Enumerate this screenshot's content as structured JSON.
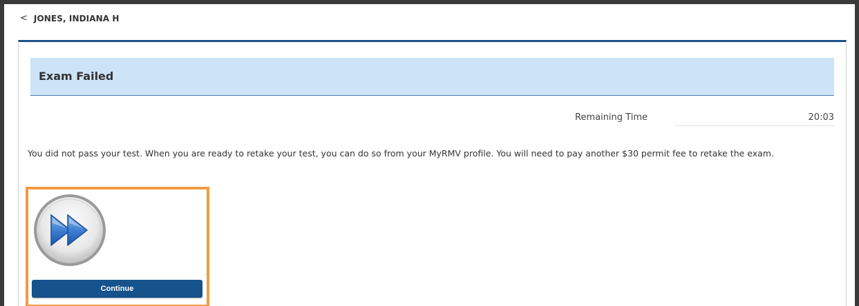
{
  "header": {
    "back_chevron": "<",
    "person_name": "JONES, INDIANA H"
  },
  "exam": {
    "title": "Exam Failed",
    "timer_label": "Remaining Time",
    "timer_value": "20:03",
    "message": "You did not pass your test. When you are ready to retake your test, you can do so from your MyRMV profile.  You will need to pay another $30 permit fee to retake the exam.",
    "continue_icon": "fast-forward-icon",
    "continue_label": "Continue"
  },
  "colors": {
    "accent": "#1d4f86",
    "title_bar_bg": "#cde3f6",
    "button_bg": "#16528b",
    "highlight": "#f39a43"
  }
}
